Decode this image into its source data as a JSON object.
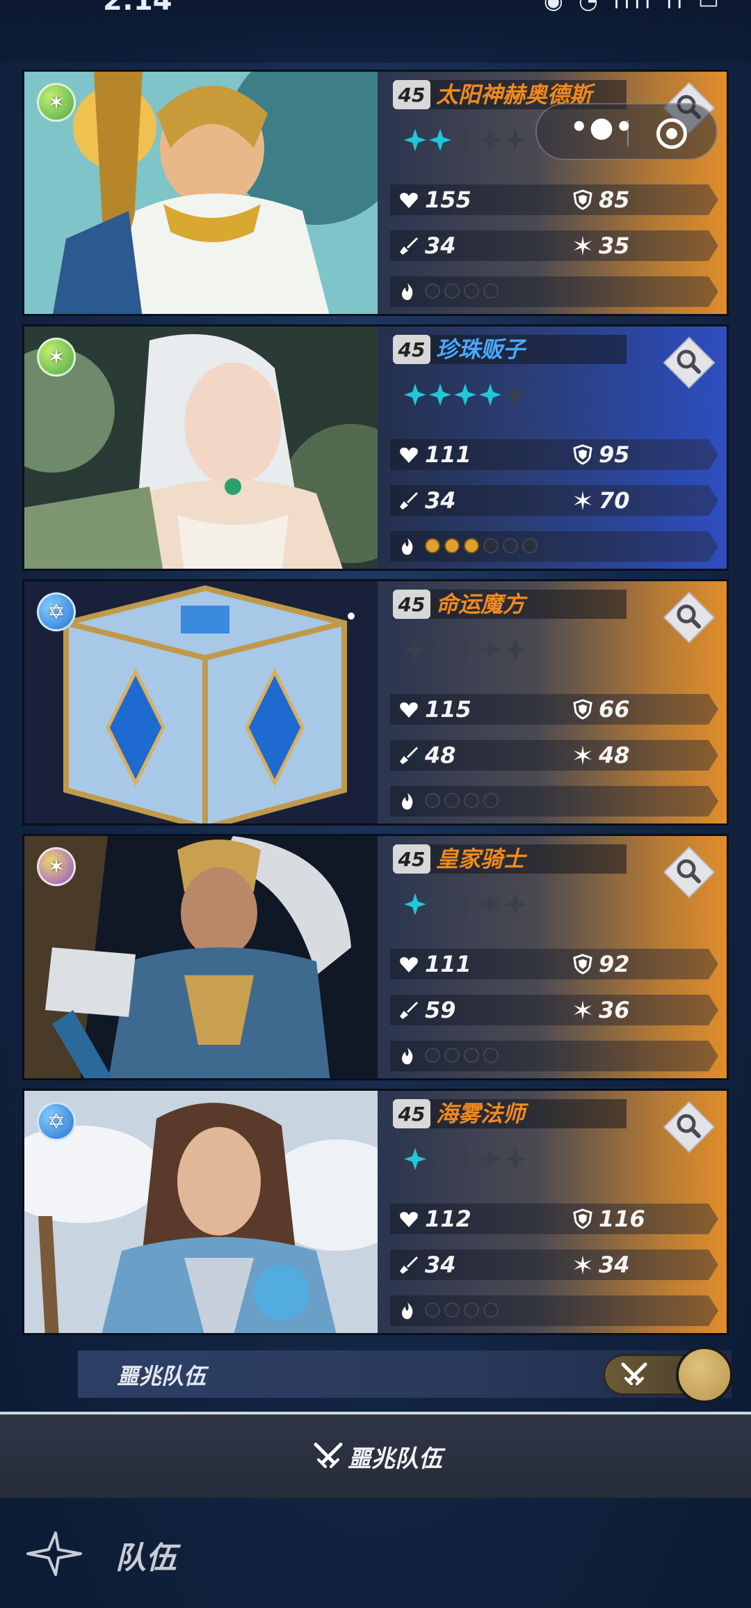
{
  "status_bar": {
    "time": "2:14",
    "icons": "◉ ◔ ılıl ıl ▭"
  },
  "mini_program": {
    "more_label": "•●•"
  },
  "colors": {
    "orange_card": "#e38f2a",
    "blue_card": "#2f4fc2",
    "star_active": "#1fc8d8",
    "star_inactive": "#3a3f4c",
    "slot_filled": "#e0a030"
  },
  "cards": [
    {
      "level": "45",
      "name": "太阳神赫奥德斯",
      "theme": "orange",
      "element": "nature",
      "stars": 2,
      "max_stars": 5,
      "hp": "155",
      "defense": "85",
      "attack": "34",
      "speed": "35",
      "slots_filled": 0,
      "slots_total": 4
    },
    {
      "level": "45",
      "name": "珍珠贩子",
      "theme": "blue",
      "element": "nature",
      "stars": 4,
      "max_stars": 5,
      "hp": "111",
      "defense": "95",
      "attack": "34",
      "speed": "70",
      "slots_filled": 3,
      "slots_total": 6
    },
    {
      "level": "45",
      "name": "命运魔方",
      "theme": "orange",
      "element": "water",
      "stars": 0,
      "max_stars": 5,
      "hp": "115",
      "defense": "66",
      "attack": "48",
      "speed": "48",
      "slots_filled": 0,
      "slots_total": 4
    },
    {
      "level": "45",
      "name": "皇家骑士",
      "theme": "orange",
      "element": "arcane",
      "stars": 1,
      "max_stars": 5,
      "hp": "111",
      "defense": "92",
      "attack": "59",
      "speed": "36",
      "slots_filled": 0,
      "slots_total": 4
    },
    {
      "level": "45",
      "name": "海雾法师",
      "theme": "orange",
      "element": "water",
      "stars": 1,
      "max_stars": 5,
      "hp": "112",
      "defense": "116",
      "attack": "34",
      "speed": "34",
      "slots_filled": 0,
      "slots_total": 4
    }
  ],
  "omen_team": {
    "label": "噩兆队伍",
    "toggle_on": true
  },
  "action": {
    "label": "噩兆队伍"
  },
  "nav": {
    "label": "队伍"
  }
}
